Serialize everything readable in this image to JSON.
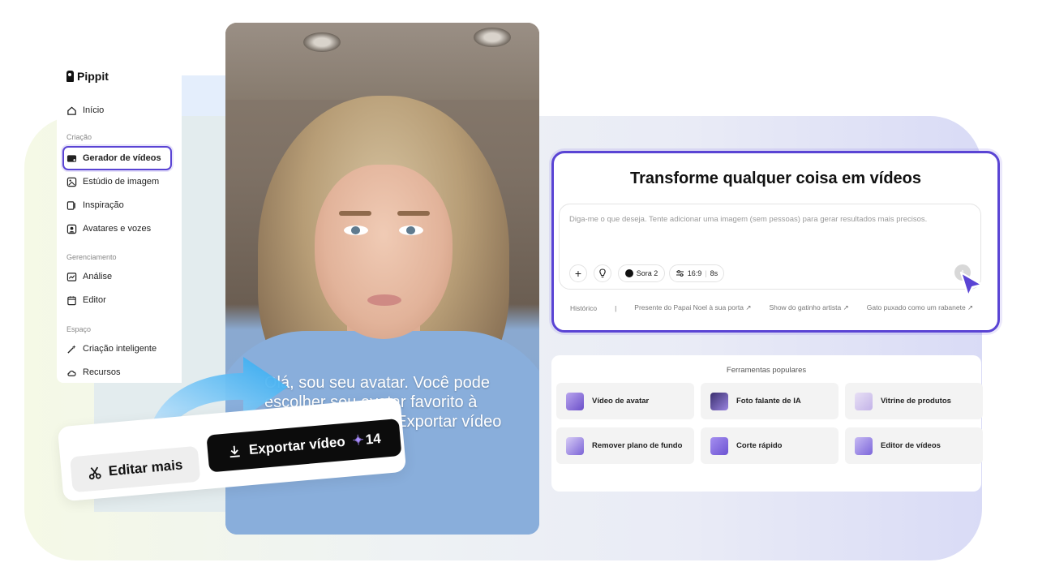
{
  "brand": {
    "name": "Pippit"
  },
  "sidebar": {
    "home": "Início",
    "sections": [
      {
        "label": "Criação",
        "items": [
          "Gerador de vídeos",
          "Estúdio de imagem",
          "Inspiração",
          "Avatares e vozes"
        ]
      },
      {
        "label": "Gerenciamento",
        "items": [
          "Análise",
          "Editor"
        ]
      },
      {
        "label": "Espaço",
        "items": [
          "Criação inteligente",
          "Recursos"
        ]
      }
    ],
    "active_item": "Gerador de vídeos"
  },
  "video": {
    "caption": "Olá, sou seu avatar. Você pode escolher seu avatar favorito à direita e clicar em Exportar vídeo para edit"
  },
  "actions": {
    "edit_label": "Editar mais",
    "export_label": "Exportar vídeo",
    "export_credits": "14"
  },
  "prompt": {
    "title": "Transforme qualquer coisa em vídeos",
    "placeholder": "Diga-me o que deseja. Tente adicionar uma imagem (sem pessoas) para gerar resultados mais precisos.",
    "model": "Sora 2",
    "aspect_ratio": "16:9",
    "duration": "8s",
    "history": "Histórico",
    "separator": "|",
    "suggestions": [
      "Presente do Papai Noel à sua porta ↗",
      "Show do gatinho artista ↗",
      "Gato puxado como um rabanete ↗"
    ]
  },
  "tools": {
    "title": "Ferramentas populares",
    "items": [
      "Vídeo de avatar",
      "Foto falante de IA",
      "Vitrine de produtos",
      "Remover plano de fundo",
      "Corte rápido",
      "Editor de vídeos"
    ]
  },
  "colors": {
    "accent": "#5a44d4",
    "export_button": "#0c0c0c"
  }
}
